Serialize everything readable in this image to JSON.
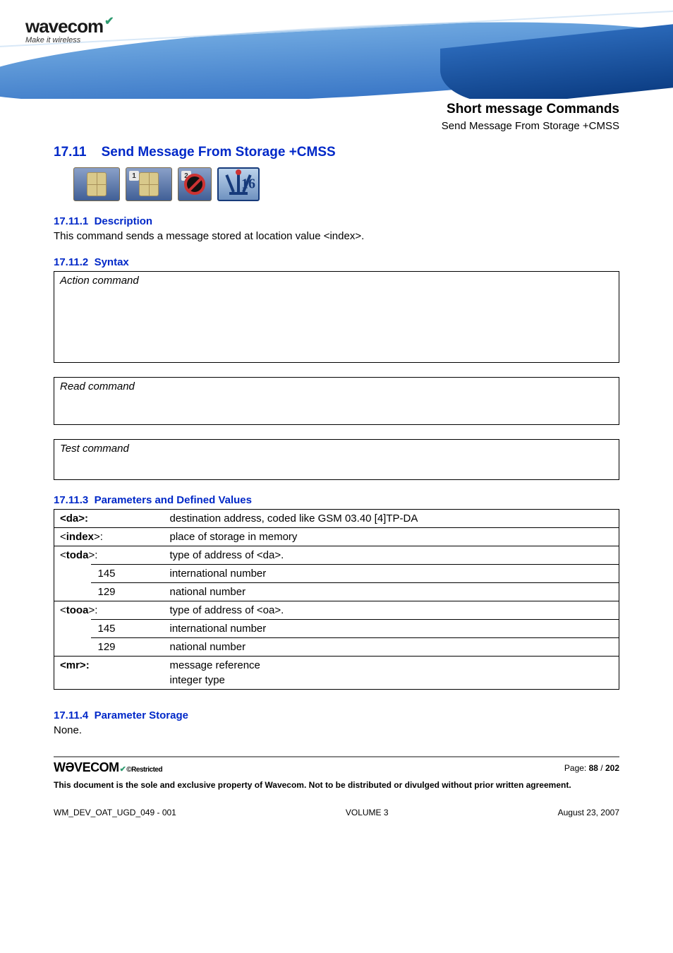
{
  "logo": {
    "brand": "wavecom",
    "tagline": "Make it wireless"
  },
  "chapter": {
    "title": "Short message Commands",
    "subtitle": "Send Message From Storage +CMSS"
  },
  "section": {
    "number": "17.11",
    "title": "Send Message From Storage +CMSS"
  },
  "icons": {
    "badge1": "1",
    "badge2": "2",
    "value16": "16"
  },
  "sub": {
    "desc_num": "17.11.1",
    "desc_title": "Description",
    "desc_text": "This command sends a message stored at location value <index>.",
    "syntax_num": "17.11.2",
    "syntax_title": "Syntax",
    "action_label": "Action command",
    "read_label": "Read command",
    "test_label": "Test command",
    "params_num": "17.11.3",
    "params_title": "Parameters and Defined Values",
    "storage_num": "17.11.4",
    "storage_title": "Parameter Storage",
    "storage_text": "None."
  },
  "params": {
    "da_key": "<da>:",
    "da_desc": "destination address, coded like GSM 03.40 [4]TP-DA",
    "index_key": "<index>:",
    "index_desc": "place of storage in memory",
    "toda_key": "<toda>:",
    "toda_desc": "type of address of <da>.",
    "toda_145_val": "145",
    "toda_145_desc": "international number",
    "toda_129_val": "129",
    "toda_129_desc": "national number",
    "tooa_key": "<tooa>:",
    "tooa_desc": "type of address of <oa>.",
    "tooa_145_val": "145",
    "tooa_145_desc": "international number",
    "tooa_129_val": "129",
    "tooa_129_desc": "national number",
    "mr_key": "<mr>:",
    "mr_desc1": "message reference",
    "mr_desc2": "integer type"
  },
  "footer": {
    "brand": "WƏVECOM",
    "restricted": "©Restricted",
    "page_prefix": "Page: ",
    "page_current": "88",
    "page_sep": " / ",
    "page_total": "202",
    "disclaimer": "This document is the sole and exclusive property of Wavecom. Not to be distributed or divulged without prior written agreement.",
    "doc_id": "WM_DEV_OAT_UGD_049 - 001",
    "volume": "VOLUME 3",
    "date": "August 23, 2007"
  }
}
